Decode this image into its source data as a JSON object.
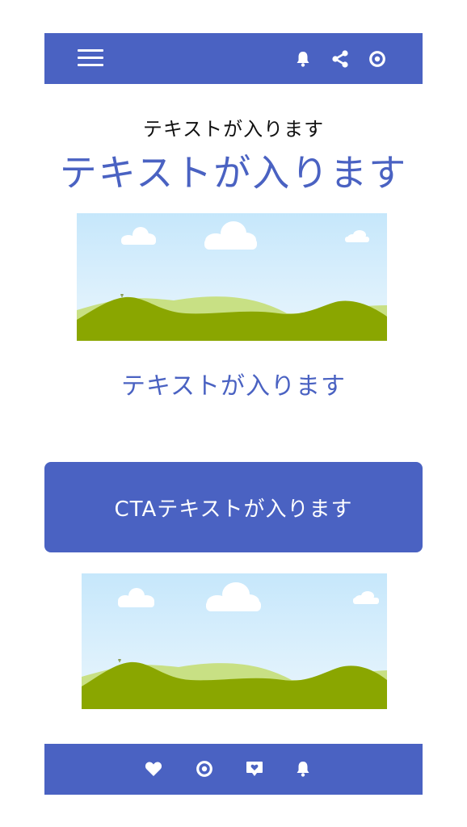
{
  "colors": {
    "brand": "#4a62c2",
    "sky": "#c9e9fb",
    "hill_dark": "#8aa600",
    "hill_light": "#c8e084",
    "text_dark": "#111111",
    "white": "#ffffff"
  },
  "header": {
    "menu_icon": "hamburger-menu-icon",
    "icons": [
      "bell-icon",
      "share-icon",
      "at-sign-icon"
    ]
  },
  "hero": {
    "eyebrow": "テキストが入ります",
    "headline": "テキストが入ります"
  },
  "section": {
    "caption": "テキストが入ります"
  },
  "cta": {
    "label": "CTAテキストが入ります"
  },
  "footer": {
    "icons": [
      "heart-icon",
      "at-sign-icon",
      "heart-message-icon",
      "bell-icon"
    ]
  }
}
